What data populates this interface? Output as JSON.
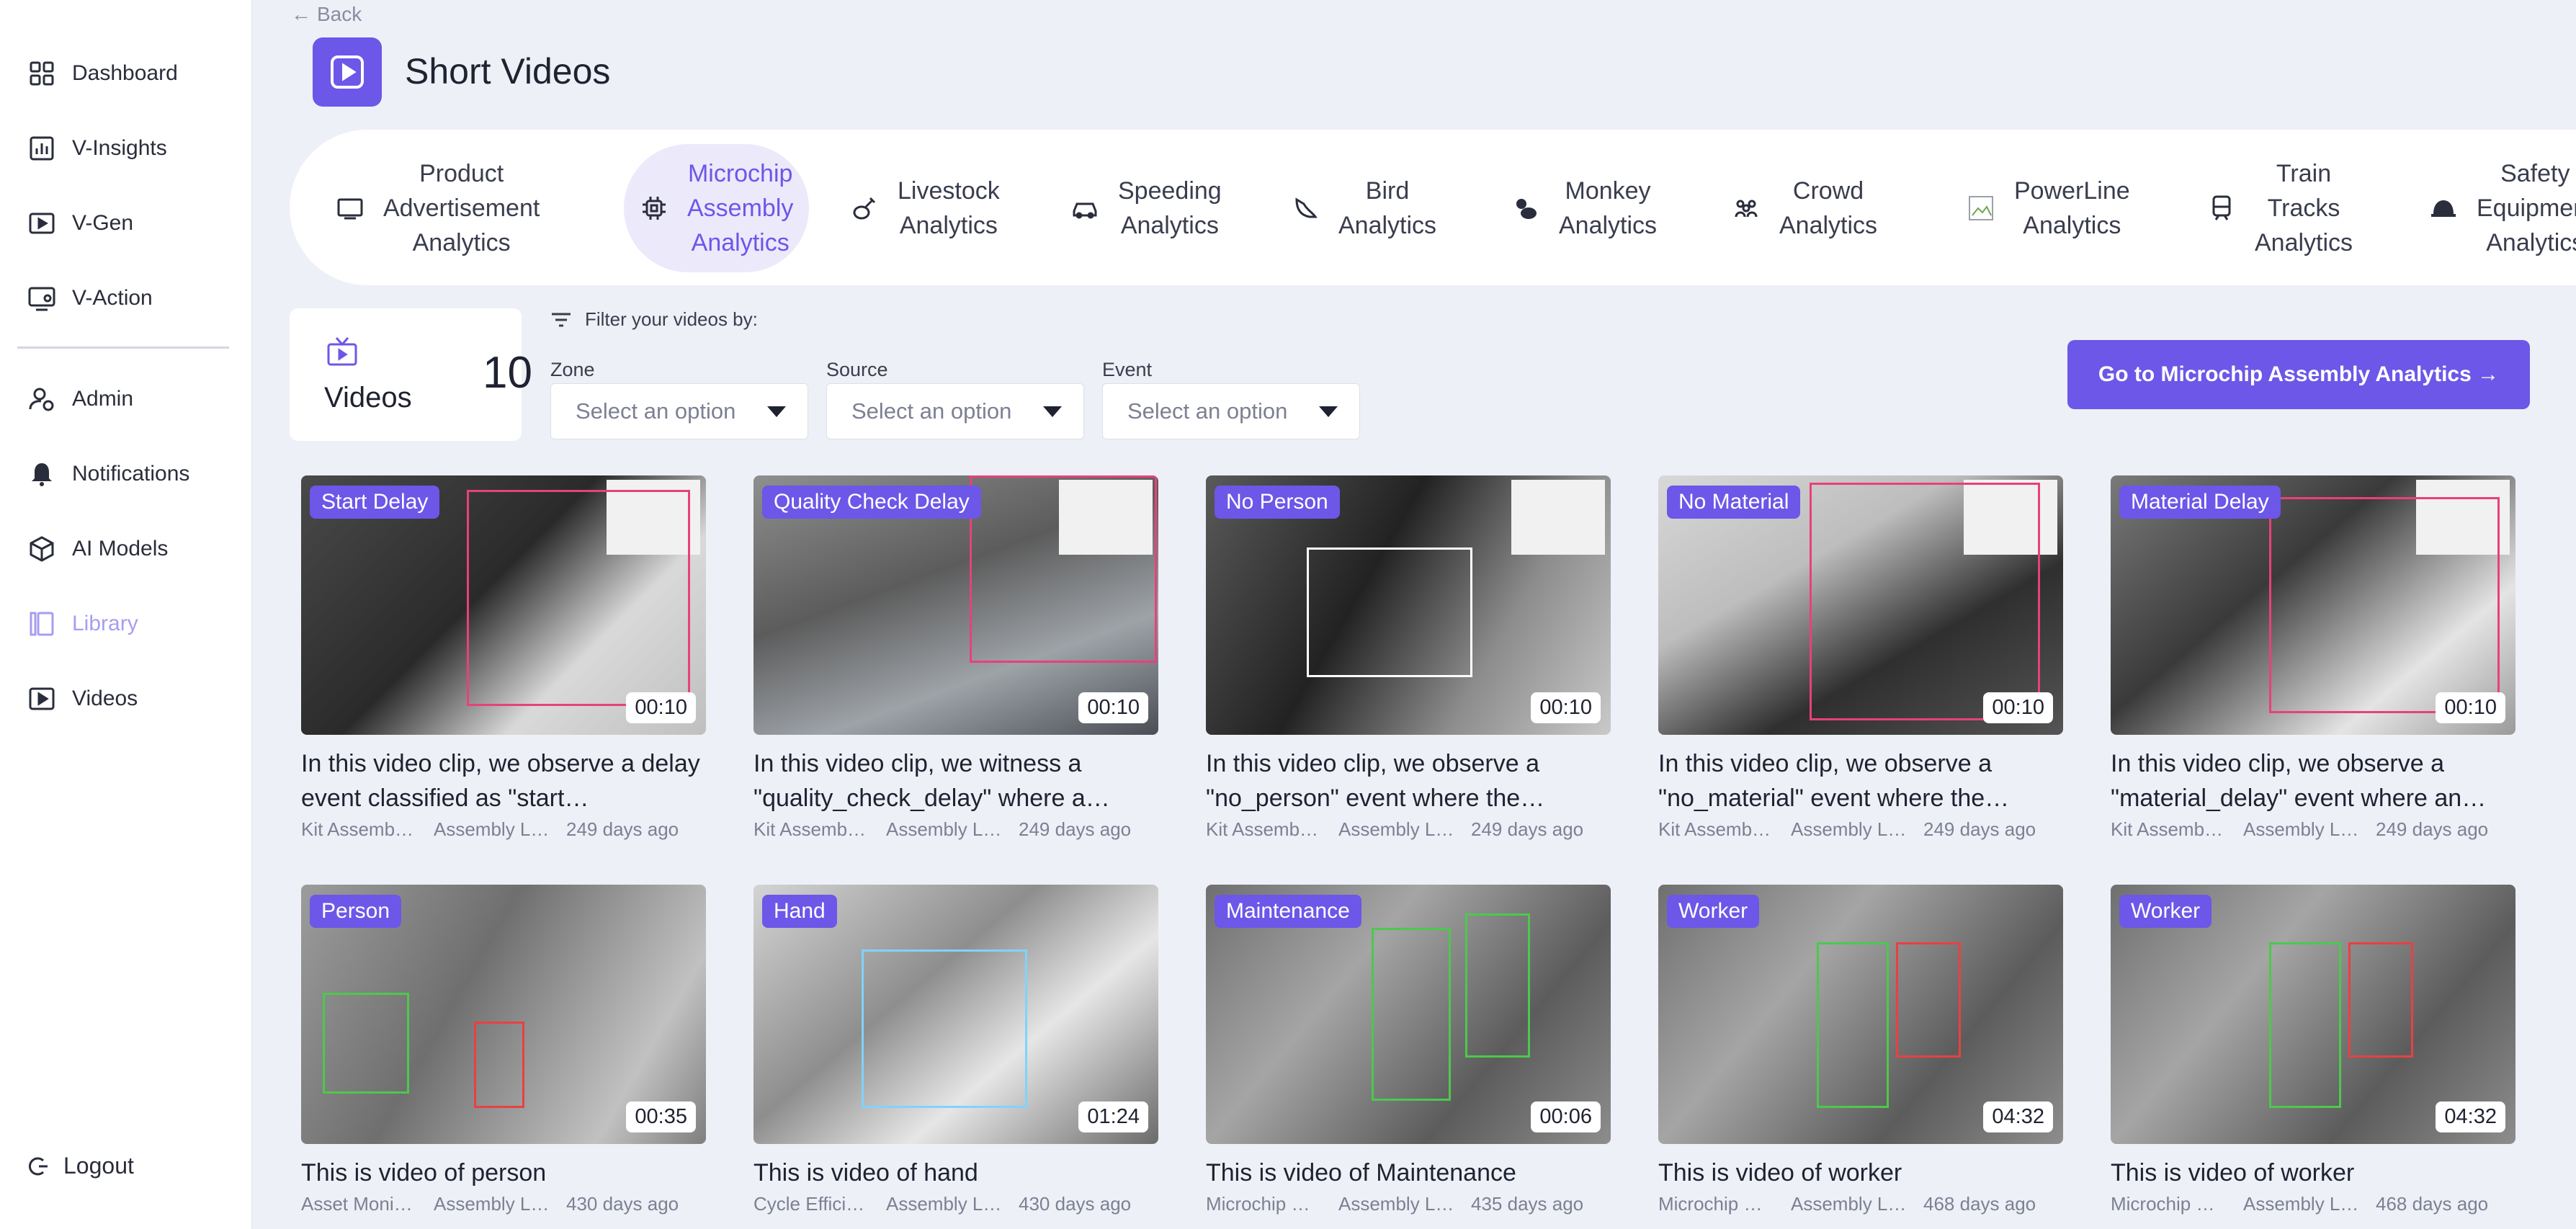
{
  "sidebar": {
    "items": [
      {
        "label": "Dashboard",
        "icon": "dashboard-icon"
      },
      {
        "label": "V-Insights",
        "icon": "chart-icon"
      },
      {
        "label": "V-Gen",
        "icon": "video-gen-icon"
      },
      {
        "label": "V-Action",
        "icon": "monitor-user-icon"
      },
      {
        "label": "Admin",
        "icon": "admin-icon"
      },
      {
        "label": "Notifications",
        "icon": "bell-icon"
      },
      {
        "label": "AI Models",
        "icon": "cube-icon"
      },
      {
        "label": "Library",
        "icon": "library-icon"
      },
      {
        "label": "Videos",
        "icon": "play-icon"
      }
    ],
    "logout": "Logout"
  },
  "header": {
    "back": "Back",
    "title": "Short Videos"
  },
  "tabs": [
    {
      "label": "Product\nAdvertisement\nAnalytics",
      "icon": "tv-icon"
    },
    {
      "label": "Microchip\nAssembly\nAnalytics",
      "icon": "chip-icon",
      "active": true
    },
    {
      "label": "Livestock\nAnalytics",
      "icon": "livestock-icon"
    },
    {
      "label": "Speeding\nAnalytics",
      "icon": "car-icon"
    },
    {
      "label": "Bird\nAnalytics",
      "icon": "bird-icon"
    },
    {
      "label": "Monkey\nAnalytics",
      "icon": "monkey-icon"
    },
    {
      "label": "Crowd\nAnalytics",
      "icon": "crowd-icon"
    },
    {
      "label": "PowerLine\nAnalytics",
      "icon": "image-placeholder-icon"
    },
    {
      "label": "Train\nTracks\nAnalytics",
      "icon": "train-icon"
    },
    {
      "label": "Safety\nEquipment\nAnalytics",
      "icon": "helmet-icon"
    }
  ],
  "summary": {
    "label": "Videos",
    "count": "10"
  },
  "filters": {
    "title": "Filter your videos by:",
    "zone": {
      "label": "Zone",
      "placeholder": "Select an option"
    },
    "source": {
      "label": "Source",
      "placeholder": "Select an option"
    },
    "event": {
      "label": "Event",
      "placeholder": "Select an option"
    }
  },
  "cta": {
    "label": "Go to Microchip Assembly Analytics →"
  },
  "videos": [
    {
      "tag": "Start Delay",
      "duration": "00:10",
      "desc": "In this video clip, we observe a delay event classified as \"start…",
      "zone": "Kit Assemb…",
      "source": "Assembly L…",
      "age": "249 days ago"
    },
    {
      "tag": "Quality Check Delay",
      "duration": "00:10",
      "desc": "In this video clip, we witness a \"quality_check_delay\" where a…",
      "zone": "Kit Assemb…",
      "source": "Assembly L…",
      "age": "249 days ago"
    },
    {
      "tag": "No Person",
      "duration": "00:10",
      "desc": "In this video clip, we observe a \"no_person\" event where the…",
      "zone": "Kit Assemb…",
      "source": "Assembly L…",
      "age": "249 days ago"
    },
    {
      "tag": "No Material",
      "duration": "00:10",
      "desc": "In this video clip, we observe a \"no_material\" event where the…",
      "zone": "Kit Assemb…",
      "source": "Assembly L…",
      "age": "249 days ago"
    },
    {
      "tag": "Material Delay",
      "duration": "00:10",
      "desc": "In this video clip, we observe a \"material_delay\" event where an…",
      "zone": "Kit Assemb…",
      "source": "Assembly L…",
      "age": "249 days ago"
    },
    {
      "tag": "Person",
      "duration": "00:35",
      "desc": "This is video of person",
      "zone": "Asset Moni…",
      "source": "Assembly L…",
      "age": "430 days ago"
    },
    {
      "tag": "Hand",
      "duration": "01:24",
      "desc": "This is video of hand",
      "zone": "Cycle Effici…",
      "source": "Assembly L…",
      "age": "430 days ago"
    },
    {
      "tag": "Maintenance",
      "duration": "00:06",
      "desc": "This is video of Maintenance",
      "zone": "Microchip …",
      "source": "Assembly L…",
      "age": "435 days ago"
    },
    {
      "tag": "Worker",
      "duration": "04:32",
      "desc": "This is video of worker",
      "zone": "Microchip …",
      "source": "Assembly L…",
      "age": "468 days ago"
    },
    {
      "tag": "Worker",
      "duration": "04:32",
      "desc": "This is video of worker",
      "zone": "Microchip …",
      "source": "Assembly L…",
      "age": "468 days ago"
    }
  ]
}
